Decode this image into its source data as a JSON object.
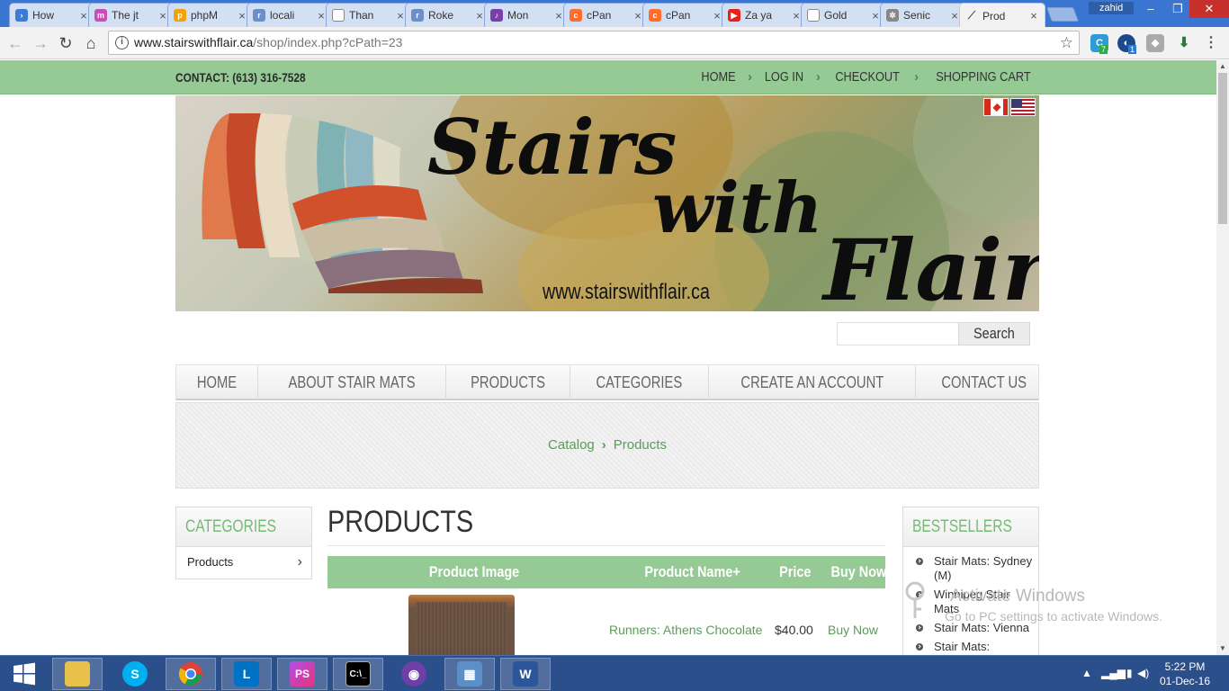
{
  "browser": {
    "tabs": [
      {
        "title": "How",
        "icon": "arrow-favicon-icon",
        "color": "#3a7bd5"
      },
      {
        "title": "The jt",
        "icon": "mastodon-favicon-icon",
        "color": "#c94fb6"
      },
      {
        "title": "phpM",
        "icon": "phpmyadmin-favicon-icon",
        "color": "#f0a30a"
      },
      {
        "title": "locali",
        "icon": "roken-favicon-icon",
        "color": "#6a8fc9"
      },
      {
        "title": "Than",
        "icon": "document-favicon-icon",
        "color": "#999999"
      },
      {
        "title": "Roke",
        "icon": "roken-favicon-icon",
        "color": "#6a8fc9"
      },
      {
        "title": "Mon",
        "icon": "podcast-favicon-icon",
        "color": "#7a3ea8"
      },
      {
        "title": "cPan",
        "icon": "cpanel-favicon-icon",
        "color": "#ff6c2c"
      },
      {
        "title": "cPan",
        "icon": "cpanel-favicon-icon",
        "color": "#ff6c2c"
      },
      {
        "title": "Za ya",
        "icon": "youtube-favicon-icon",
        "color": "#e62117"
      },
      {
        "title": "Gold",
        "icon": "document-favicon-icon",
        "color": "#999999"
      },
      {
        "title": "Senic",
        "icon": "gear-favicon-icon",
        "color": "#888888"
      },
      {
        "title": "Prod",
        "icon": "stairs-favicon-icon",
        "color": "#555555"
      }
    ],
    "user_badge": "zahid",
    "url_host": "www.stairswithflair.ca",
    "url_path": "/shop/index.php?cPath=23",
    "ext_badges": [
      "7",
      "1"
    ]
  },
  "site": {
    "contact": "CONTACT: (613) 316-7528",
    "topnav": [
      "HOME",
      "LOG IN",
      "CHECKOUT",
      "SHOPPING CART"
    ],
    "banner": {
      "title_line1": "Stairs",
      "title_line2": "with",
      "title_line3": "Flair",
      "url": "www.stairswithflair.ca"
    },
    "search": {
      "placeholder": "",
      "button": "Search"
    },
    "mainnav": [
      "HOME",
      "ABOUT STAIR MATS",
      "PRODUCTS",
      "CATEGORIES",
      "CREATE AN ACCOUNT",
      "CONTACT US"
    ],
    "breadcrumb": [
      "Catalog",
      "Products"
    ],
    "categories": {
      "heading": "CATEGORIES",
      "items": [
        "Products"
      ]
    },
    "page_title": "PRODUCTS",
    "table": {
      "headers": {
        "image": "Product Image",
        "name": "Product Name+",
        "price": "Price",
        "buy": "Buy Now"
      },
      "rows": [
        {
          "name": "Runners: Athens Chocolate",
          "price": "$40.00",
          "buy": "Buy Now"
        }
      ]
    },
    "bestsellers": {
      "heading": "BESTSELLERS",
      "items": [
        "Stair Mats: Sydney (M)",
        "Winnipeg Stair Mats",
        "Stair Mats: Vienna",
        "Stair Mats:"
      ]
    }
  },
  "watermark": {
    "line1": "Activate Windows",
    "line2": "Go to PC settings to activate Windows."
  },
  "taskbar": {
    "apps": [
      "start-icon",
      "file-explorer-icon",
      "skype-icon",
      "chrome-icon",
      "lync-icon",
      "phpstorm-icon",
      "cmd-icon",
      "github-icon",
      "network-icon",
      "word-icon"
    ],
    "time": "5:22 PM",
    "date": "01-Dec-16"
  },
  "colors": {
    "accent_green": "#95ca94",
    "link_green": "#5c9b5b",
    "heading_green": "#7ab879",
    "taskbar": "#2b4f8a"
  }
}
